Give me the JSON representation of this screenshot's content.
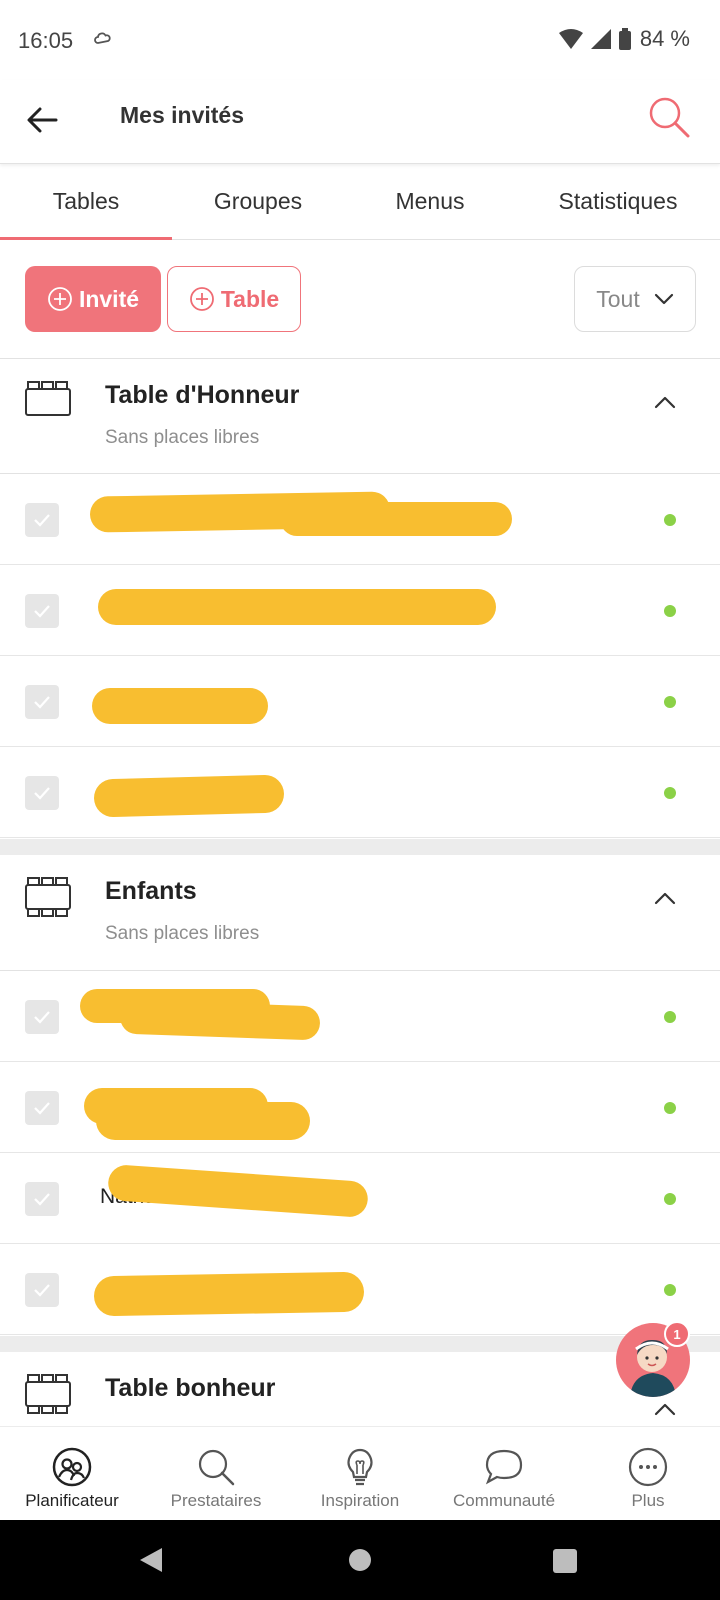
{
  "status_bar": {
    "time": "16:05",
    "battery": "84 %"
  },
  "header": {
    "title": "Mes invités"
  },
  "tabs": [
    {
      "label": "Tables",
      "active": true
    },
    {
      "label": "Groupes",
      "active": false
    },
    {
      "label": "Menus",
      "active": false
    },
    {
      "label": "Statistiques",
      "active": false
    }
  ],
  "actions": {
    "invite_label": "Invité",
    "table_label": "Table",
    "filter_value": "Tout"
  },
  "sections": [
    {
      "title": "Table d'Honneur",
      "subtitle": "Sans places libres",
      "guests": [
        {
          "name": "",
          "redacted": true
        },
        {
          "name": "A",
          "redacted": true
        },
        {
          "name": "",
          "redacted": true
        },
        {
          "name": "",
          "redacted": true
        }
      ]
    },
    {
      "title": "Enfants",
      "subtitle": "Sans places libres",
      "guests": [
        {
          "name": "Lo",
          "redacted": true
        },
        {
          "name": "",
          "redacted": true
        },
        {
          "name": "Nathan",
          "redacted": true
        },
        {
          "name": "",
          "redacted": true
        }
      ]
    },
    {
      "title": "Table bonheur"
    }
  ],
  "chat": {
    "badge_count": "1"
  },
  "bottom_nav": [
    {
      "label": "Planificateur",
      "icon": "planner-icon",
      "active": true
    },
    {
      "label": "Prestataires",
      "icon": "search-icon",
      "active": false
    },
    {
      "label": "Inspiration",
      "icon": "lightbulb-icon",
      "active": false
    },
    {
      "label": "Communauté",
      "icon": "chat-bubble-icon",
      "active": false
    },
    {
      "label": "Plus",
      "icon": "more-icon",
      "active": false
    }
  ],
  "colors": {
    "accent": "#ef6b73",
    "present_dot": "#8bd147",
    "redaction": "#f8be30"
  }
}
